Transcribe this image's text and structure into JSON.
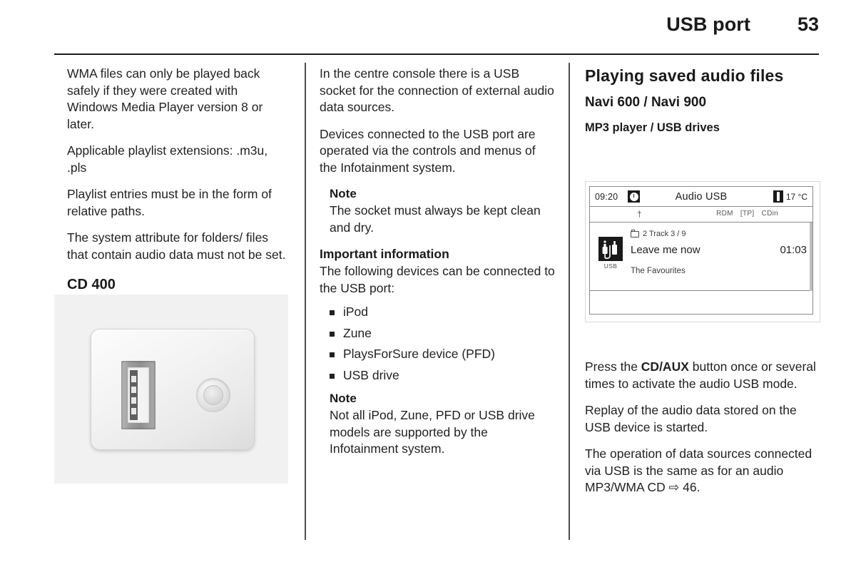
{
  "header": {
    "title": "USB port",
    "page_number": "53"
  },
  "left_column": {
    "paragraphs": [
      "WMA files can only be played back safely if they were created with Windows Media Player version 8 or later.",
      "Applicable playlist extensions: .m3u, .pls",
      "Playlist entries must be in the form of relative paths.",
      "The system attribute for folders/ files that contain audio data must not be set."
    ],
    "heading_cd400": "CD 400",
    "photo_caption": "usb-port-photo"
  },
  "middle_column": {
    "paragraph_1": "In the centre console there is a USB socket for the connection of external audio data sources.",
    "paragraph_2": "Devices connected to the USB port are operated via the controls and menus of the Infotainment system.",
    "note_1": {
      "title": "Note",
      "body": "The socket must always be kept clean and dry."
    },
    "important": {
      "title": "Important information",
      "body": "The following devices can be connected to the USB port:"
    },
    "device_list": [
      "iPod",
      "Zune",
      "PlaysForSure device (PFD)",
      "USB drive"
    ],
    "note_2": {
      "title": "Note",
      "body": "Not all iPod, Zune, PFD or USB drive models are supported by the Infotainment system."
    }
  },
  "right_column": {
    "heading_main": "Playing saved audio files",
    "heading_sub": "Navi 600 / Navi 900",
    "heading_sub2": "MP3 player / USB drives",
    "infotainment_screen": {
      "time": "09:20",
      "clock_icon": "clock-icon",
      "title": "Audio USB",
      "bluetooth_icon": "bluetooth-icon",
      "temperature": "17 °C",
      "temperature_icon": "thermometer-icon",
      "status_flags": [
        "RDM",
        "[TP]",
        "CDin"
      ],
      "folder_line": "2  Track 3 / 9",
      "folder_icon": "folder-icon",
      "source_icon": "usb-plug-icon",
      "source_label": "USB",
      "track_title": "Leave me now",
      "elapsed_time": "01:03",
      "album": "The Favourites"
    },
    "paragraph_1_pre": "Press the ",
    "paragraph_1_bold": "CD/AUX",
    "paragraph_1_post": " button once or several times to activate the audio USB mode.",
    "paragraph_2": "Replay of the audio data stored on the USB device is started.",
    "paragraph_3_pre": "The operation of data sources connected via USB is the same as for an audio MP3/WMA CD ",
    "paragraph_3_ref": "⇨ 46."
  }
}
